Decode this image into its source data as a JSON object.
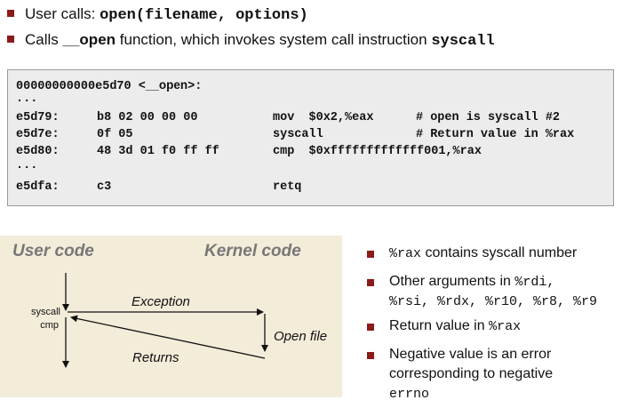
{
  "top": {
    "line1": {
      "pre": "User calls: ",
      "code": "open(filename, options)"
    },
    "line2": {
      "pre": "Calls ",
      "fn": "__open",
      "mid": " function, which invokes system call instruction ",
      "code": "syscall"
    }
  },
  "code": {
    "header_addr": "00000000000e5d70 <",
    "header_sym": "__open",
    "header_end": ">:",
    "dots1": "...",
    "rows": [
      {
        "addr": "e5d79:",
        "bytes": "b8 02 00 00 00",
        "instr": "mov  $0x2,%eax",
        "comment": "# open is syscall #2"
      },
      {
        "addr": "e5d7e:",
        "bytes": "0f 05",
        "instr": "syscall",
        "comment": "# Return value in %rax"
      },
      {
        "addr": "e5d80:",
        "bytes": "48 3d 01 f0 ff ff",
        "instr": "cmp  $0xfffffffffffff001,%rax",
        "comment": ""
      }
    ],
    "dots2": "...",
    "last": {
      "addr": "e5dfa:",
      "bytes": "c3",
      "instr": "retq"
    }
  },
  "diagram": {
    "user_code": "User code",
    "kernel_code": "Kernel code",
    "exception": "Exception",
    "returns": "Returns",
    "open_file": "Open file",
    "syscall": "syscall",
    "cmp": "cmp"
  },
  "right": {
    "b1": {
      "code": "%rax",
      "text": " contains syscall number"
    },
    "b2": {
      "text": "Other arguments in ",
      "code1": "%rdi,",
      "line2": "%rsi, %rdx, %r10, %r8, %r9"
    },
    "b3": {
      "text": "Return value in ",
      "code": "%rax"
    },
    "b4": {
      "line1": "Negative value is an error",
      "line2": "corresponding to negative",
      "code": "errno"
    }
  },
  "colors": {
    "bullet": "#8b1a1a",
    "code_bg": "#ececec",
    "diagram_bg": "#f3ecd9"
  }
}
